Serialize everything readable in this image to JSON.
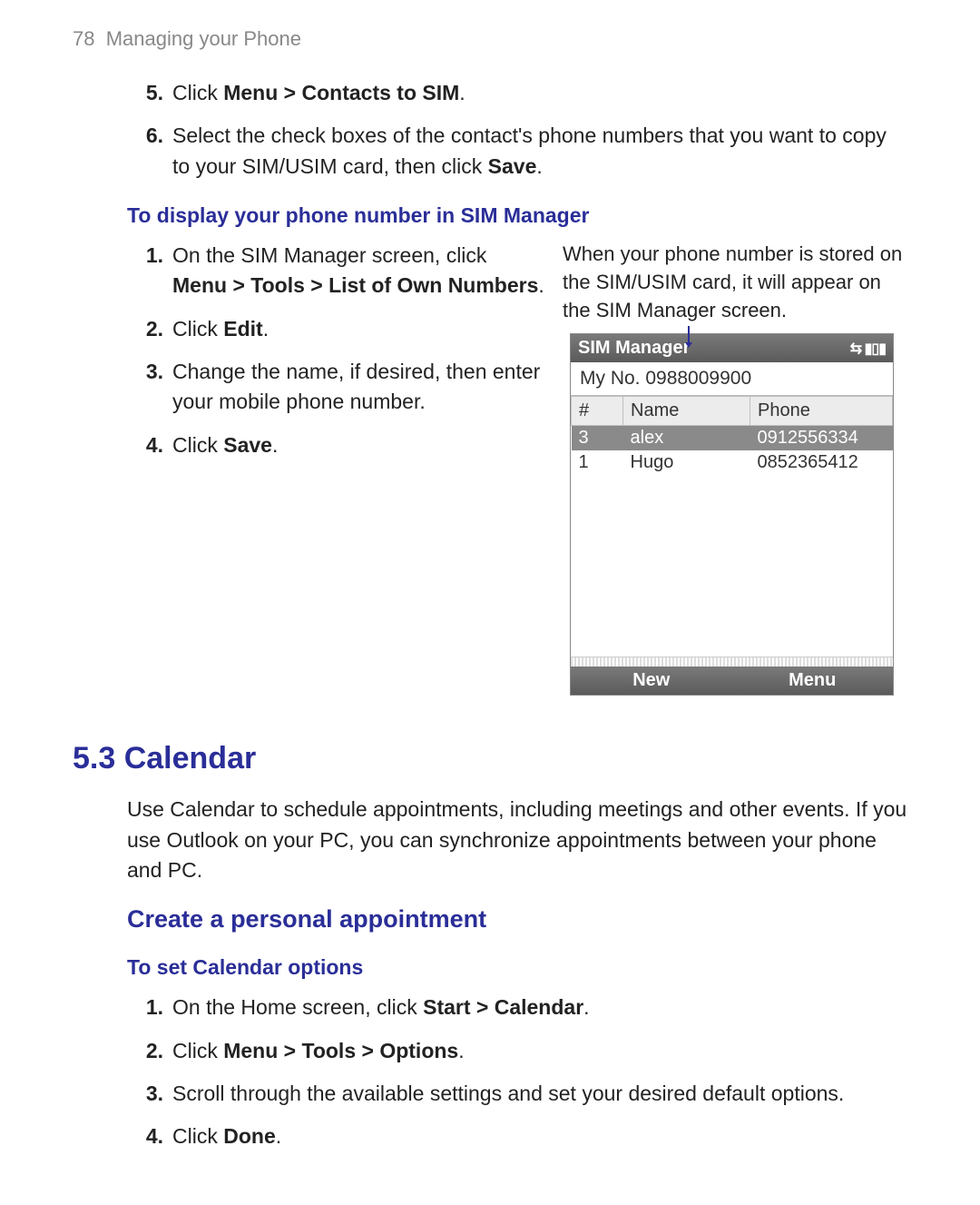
{
  "header": {
    "page_number": "78",
    "chapter": "Managing your Phone"
  },
  "top_steps": [
    {
      "num": "5.",
      "parts": [
        "Click ",
        {
          "b": "Menu > Contacts to SIM"
        },
        "."
      ]
    },
    {
      "num": "6.",
      "parts": [
        "Select the check boxes of the contact's phone numbers that you want to copy to your SIM/USIM card, then click ",
        {
          "b": "Save"
        },
        "."
      ]
    }
  ],
  "sim_section": {
    "heading": "To display your phone number in SIM Manager",
    "left_steps": [
      {
        "num": "1.",
        "parts": [
          "On the SIM Manager screen, click ",
          {
            "b": "Menu > Tools > List of Own Numbers"
          },
          "."
        ]
      },
      {
        "num": "2.",
        "parts": [
          "Click ",
          {
            "b": "Edit"
          },
          "."
        ]
      },
      {
        "num": "3.",
        "parts": [
          "Change the name, if desired, then enter your mobile phone number."
        ]
      },
      {
        "num": "4.",
        "parts": [
          "Click ",
          {
            "b": "Save"
          },
          "."
        ]
      }
    ],
    "caption": "When your phone number is stored on the SIM/USIM card, it will appear on the SIM Manager screen.",
    "shot": {
      "title": "SIM Manager",
      "status_glyphs": "⇆ ▮▯▮",
      "my_no": "My No. 0988009900",
      "columns": {
        "idx": "#",
        "name": "Name",
        "phone": "Phone"
      },
      "rows": [
        {
          "idx": "3",
          "name": "alex",
          "phone": "0912556334",
          "selected": true
        },
        {
          "idx": "1",
          "name": "Hugo",
          "phone": "0852365412",
          "selected": false
        }
      ],
      "soft_left": "New",
      "soft_right": "Menu"
    }
  },
  "calendar": {
    "title": "5.3 Calendar",
    "intro": "Use Calendar to schedule appointments, including meetings and other events. If you use Outlook on your PC, you can synchronize appointments between your phone and PC.",
    "topic": "Create a personal appointment",
    "sub": "To set Calendar options",
    "steps": [
      {
        "num": "1.",
        "parts": [
          "On the Home screen, click ",
          {
            "b": "Start > Calendar"
          },
          "."
        ]
      },
      {
        "num": "2.",
        "parts": [
          "Click ",
          {
            "b": "Menu > Tools > Options"
          },
          "."
        ]
      },
      {
        "num": "3.",
        "parts": [
          "Scroll through the available settings and set your desired default options."
        ]
      },
      {
        "num": "4.",
        "parts": [
          "Click ",
          {
            "b": "Done"
          },
          "."
        ]
      }
    ]
  }
}
